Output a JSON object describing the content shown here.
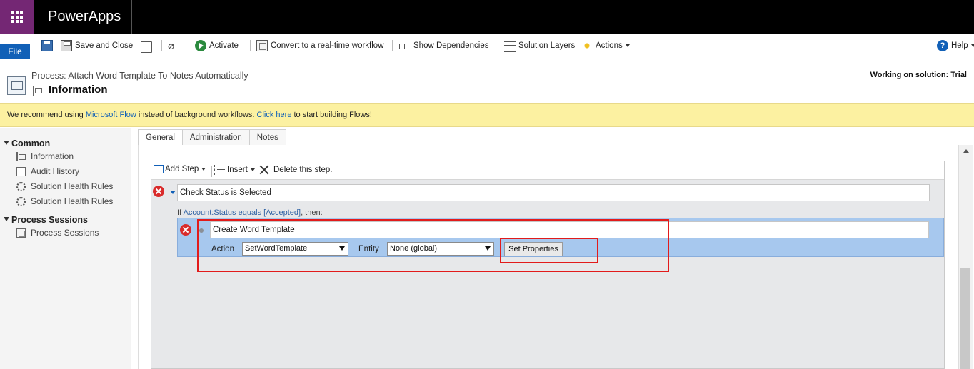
{
  "app": {
    "title": "PowerApps"
  },
  "commandbar": {
    "file": "File",
    "save_close": "Save and Close",
    "activate": "Activate",
    "convert": "Convert to a real-time workflow",
    "show_dependencies": "Show Dependencies",
    "solution_layers": "Solution Layers",
    "actions": "Actions",
    "help": "Help"
  },
  "header": {
    "process_label": "Process: Attach Word Template To Notes Automatically",
    "title": "Information",
    "working_on": "Working on solution: Trial"
  },
  "banner": {
    "text_before": "We recommend using ",
    "link1": "Microsoft Flow",
    "text_middle": " instead of background workflows. ",
    "link2": "Click here",
    "text_after": " to start building Flows!",
    "background": "#fcf1a1"
  },
  "leftnav": {
    "groups": [
      {
        "label": "Common",
        "items": [
          "Information",
          "Audit History",
          "Solution Health Rules",
          "Solution Health Rules"
        ]
      },
      {
        "label": "Process Sessions",
        "items": [
          "Process Sessions"
        ]
      }
    ]
  },
  "tabs": [
    "General",
    "Administration",
    "Notes"
  ],
  "designer": {
    "toolbar": {
      "add_step": "Add Step",
      "insert": "Insert",
      "delete": "Delete this step."
    },
    "condition_step": "Check Status is Selected",
    "condition": {
      "prefix": "If ",
      "link": "Account:Status equals [Accepted]",
      "suffix": ", then:"
    },
    "action_step": {
      "name": "Create Word Template",
      "action_label": "Action",
      "action_value": "SetWordTemplate",
      "entity_label": "Entity",
      "entity_value": "None (global)",
      "set_properties": "Set Properties"
    }
  },
  "colors": {
    "accent": "#1160b7",
    "waffle": "#742774",
    "highlight": "#e21b1b",
    "selected_row": "#a7c8ee"
  },
  "icons": [
    "waffle-icon",
    "save-icon",
    "save-close-icon",
    "print-icon",
    "attach-icon",
    "activate-icon",
    "convert-icon",
    "dependencies-icon",
    "layers-icon",
    "actions-icon",
    "help-icon",
    "error-icon"
  ]
}
